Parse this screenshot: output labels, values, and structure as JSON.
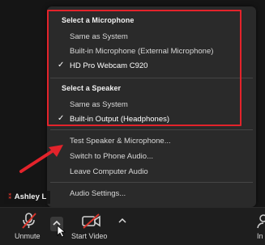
{
  "menu": {
    "microphone_header": "Select a Microphone",
    "microphones": [
      {
        "label": "Same as System",
        "checked": false
      },
      {
        "label": "Built-in Microphone (External Microphone)",
        "checked": false
      },
      {
        "label": "HD Pro Webcam C920",
        "checked": true
      }
    ],
    "speaker_header": "Select a Speaker",
    "speakers": [
      {
        "label": "Same as System",
        "checked": false
      },
      {
        "label": "Built-in Output (Headphones)",
        "checked": true
      }
    ],
    "actions": [
      "Test Speaker & Microphone...",
      "Switch to Phone Audio...",
      "Leave Computer Audio"
    ],
    "settings": "Audio Settings...",
    "check_glyph": "✓"
  },
  "participant": {
    "name": "Ashley L"
  },
  "controls": {
    "unmute_label": "Unmute",
    "start_video_label": "Start Video",
    "right_partial_label": "In"
  },
  "colors": {
    "highlight": "#e3232b",
    "arrow": "#e3232b",
    "muted_red": "#d9342b"
  }
}
